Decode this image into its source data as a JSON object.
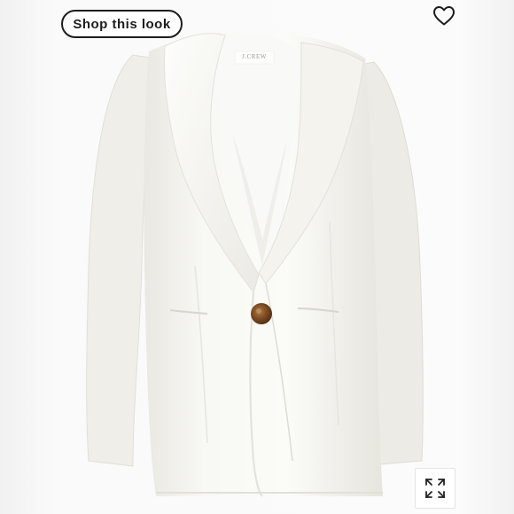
{
  "shop_button": {
    "label": "Shop this look"
  },
  "photo": {
    "brand_label": "J.CREW"
  },
  "icons": {
    "favorite": "heart-outline-icon",
    "expand": "expand-arrows-icon"
  },
  "colors": {
    "button_border": "#1c1c1c",
    "blazer": "#f7f6f1",
    "button_horn": "#8a5a2b"
  }
}
